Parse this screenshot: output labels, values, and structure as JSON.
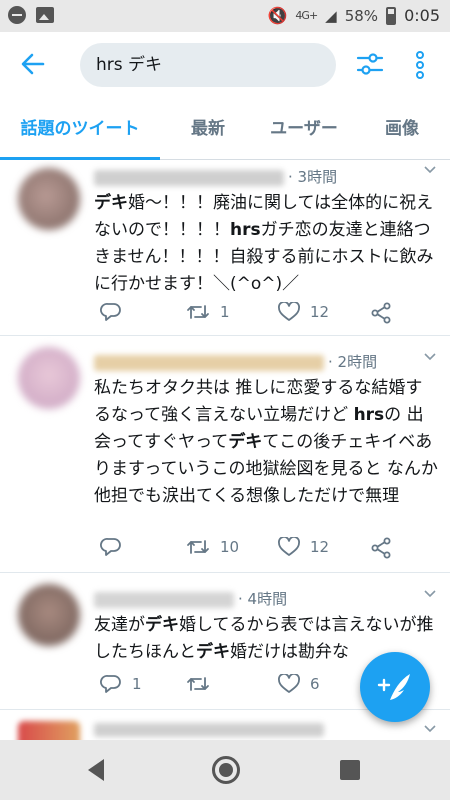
{
  "status_bar": {
    "network": "4G+",
    "battery": "58%",
    "time": "0:05"
  },
  "search": {
    "query": "hrs デキ"
  },
  "tabs": [
    {
      "label": "話題のツイート"
    },
    {
      "label": "最新"
    },
    {
      "label": "ユーザー"
    },
    {
      "label": "画像"
    }
  ],
  "tweets": [
    {
      "time": "· 3時間",
      "body": [
        {
          "text": "デキ",
          "bold": true
        },
        {
          "text": "婚〜！！！廃油に関しては全体的に祝えないので！！！！",
          "bold": false
        },
        {
          "text": "hrs",
          "bold": true
        },
        {
          "text": "ガチ恋の友達と連絡つきません！！！！自殺する前にホストに飲みに行かせます！＼(^o^)／",
          "bold": false
        }
      ],
      "replies": "",
      "retweets": "1",
      "likes": "12"
    },
    {
      "time": "· 2時間",
      "body": [
        {
          "text": "私たちオタク共は 推しに恋愛するな結婚するなって強く言えない立場だけど ",
          "bold": false
        },
        {
          "text": "hrs",
          "bold": true
        },
        {
          "text": "の 出会ってすぐヤって",
          "bold": false
        },
        {
          "text": "デキ",
          "bold": true
        },
        {
          "text": "てこの後チェキイベありますっていうこの地獄絵図を見ると なんか 他担でも涙出てくる想像しただけで無理",
          "bold": false
        }
      ],
      "replies": "",
      "retweets": "10",
      "likes": "12"
    },
    {
      "time": "· 4時間",
      "body": [
        {
          "text": "友達が",
          "bold": false
        },
        {
          "text": "デキ",
          "bold": true
        },
        {
          "text": "婚してるから表では言えないが推したちほんと",
          "bold": false
        },
        {
          "text": "デキ",
          "bold": true
        },
        {
          "text": "婚だけは勘弁な",
          "bold": false
        }
      ],
      "replies": "1",
      "retweets": "",
      "likes": "6"
    }
  ],
  "colors": {
    "accent": "#1da1f2",
    "text": "#14171a",
    "muted": "#657786"
  },
  "icons": {
    "back": "arrow-left-icon",
    "filter": "sliders-icon",
    "more": "vertical-dots-icon",
    "reply": "reply-icon",
    "retweet": "retweet-icon",
    "like": "heart-icon",
    "share": "share-icon",
    "compose": "compose-tweet-icon"
  }
}
